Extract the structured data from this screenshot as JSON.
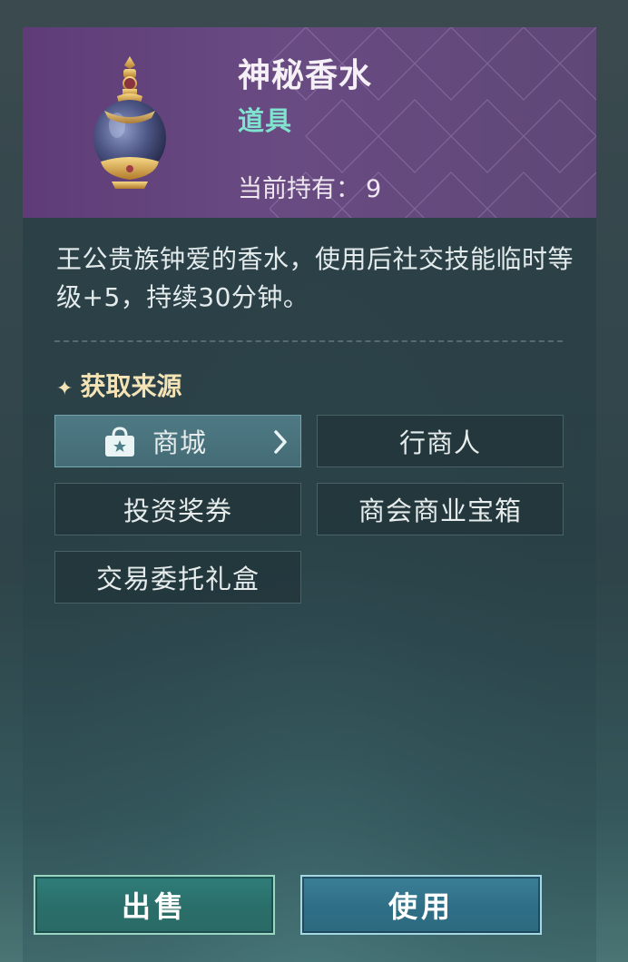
{
  "item": {
    "name": "神秘香水",
    "type": "道具",
    "owned_label": "当前持有：",
    "owned_count": "9",
    "description": "王公贵族钟爱的香水，使用后社交技能临时等级+5，持续30分钟。"
  },
  "sources": {
    "title": "获取来源",
    "title_icon": "sparkle-icon",
    "items": [
      {
        "label": "商城",
        "icon": "shop-bag-icon",
        "active": true
      },
      {
        "label": "行商人",
        "active": false
      },
      {
        "label": "投资奖券",
        "active": false
      },
      {
        "label": "商会商业宝箱",
        "active": false
      },
      {
        "label": "交易委托礼盒",
        "active": false
      }
    ]
  },
  "actions": {
    "sell_label": "出售",
    "use_label": "使用"
  },
  "colors": {
    "header_bg": "#664a80",
    "type_color": "#7fe3cf",
    "source_title_color": "#f3e3b5",
    "sell_button": "#2f7e79",
    "use_button": "#3a7f97"
  }
}
